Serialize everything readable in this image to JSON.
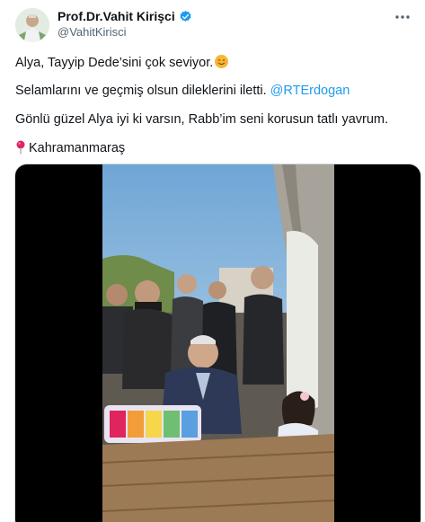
{
  "author": {
    "display_name": "Prof.Dr.Vahit Kirişci",
    "handle": "@VahitKirisci",
    "verified": true,
    "verified_color": "#1d9bf0"
  },
  "menu": {
    "more_icon": "more-icon"
  },
  "tweet": {
    "line1": "Alya, Tayyip Dede’sini çok seviyor.",
    "line2_prefix": "Selamlarını ve geçmiş olsun dileklerini iletti. ",
    "line2_mention": "@RTErdogan",
    "line3": "Gönlü güzel Alya iyi ki varsın, Rabb’im seni korusun tatlı yavrum.",
    "line4": "Kahramanmaraş"
  },
  "colors": {
    "link": "#1d9bf0",
    "text": "#0f1419",
    "muted": "#536471"
  }
}
